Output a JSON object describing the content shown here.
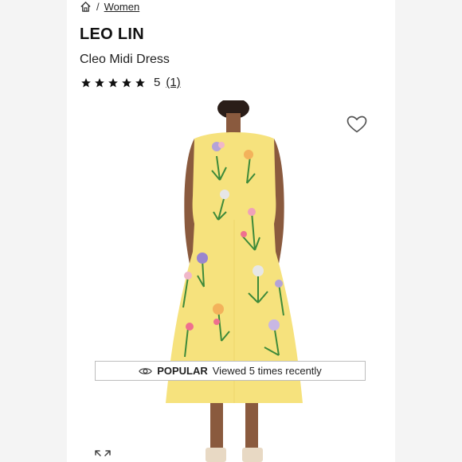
{
  "breadcrumb": {
    "home_icon": "home-icon",
    "separator": "/",
    "category": "Women"
  },
  "product": {
    "brand": "LEO LIN",
    "name": "Cleo Midi Dress",
    "rating": {
      "stars": 5,
      "score": "5",
      "count_label": "(1)"
    }
  },
  "badge": {
    "label": "POPULAR",
    "text": "Viewed 5 times recently",
    "icon": "eye-icon"
  },
  "actions": {
    "favorite_icon": "heart-icon",
    "expand_icon": "expand-icon"
  },
  "colors": {
    "dress": "#f6e27d",
    "background": "#f4f4f4"
  }
}
